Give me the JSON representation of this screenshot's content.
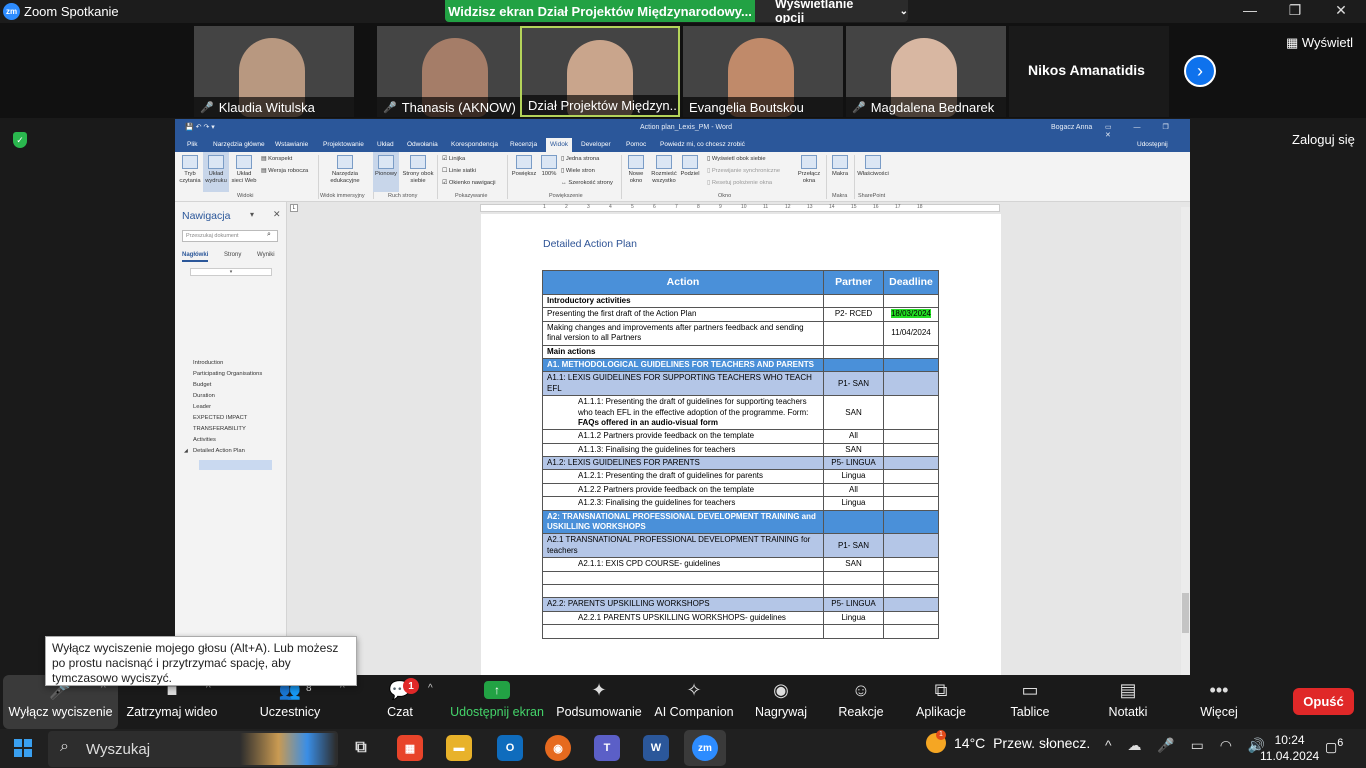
{
  "app": {
    "title": "Zoom Spotkanie",
    "logo_text": "zm"
  },
  "share_banner": {
    "text": "Widzisz ekran Dział Projektów Międzynarodowy...",
    "view_options": "Wyświetlanie opcji"
  },
  "window_controls": {
    "minimize": "—",
    "maximize": "❐",
    "close": "✕"
  },
  "participants": [
    {
      "name": "Klaudia Witulska",
      "muted": true,
      "face": "#b89880"
    },
    {
      "name": "Thanasis (AKNOW)",
      "muted": true,
      "face": "#a57d68"
    },
    {
      "name": "Dział Projektów Międzyn...",
      "muted": false,
      "face": "#c9a58c"
    },
    {
      "name": "Evangelia Boutskou",
      "muted": false,
      "face": "#c08a6a"
    },
    {
      "name": "Magdalena Bednarek",
      "muted": true,
      "face": "#d8b7a2"
    },
    {
      "name": "Nikos Amanatidis",
      "muted": true
    }
  ],
  "strip": {
    "featured_name": "Nikos Amanatidis",
    "view_label": "Wyświetl",
    "next_icon": "chevron-right-icon"
  },
  "side": {
    "login": "Zaloguj się"
  },
  "word": {
    "title": "Action plan_Lexis_PM  -  Word",
    "user": "Bogacz Anna",
    "tabs": [
      "Plik",
      "Narzędzia główne",
      "Wstawianie",
      "Projektowanie",
      "Układ",
      "Odwołania",
      "Korespondencja",
      "Recenzja",
      "Widok",
      "Developer",
      "Pomoc",
      "Powiedz mi, co chcesz zrobić"
    ],
    "active_tab": "Widok",
    "share": "Udostępnij",
    "ribbon": {
      "views": [
        "Tryb czytania",
        "Układ wydruku",
        "Układ sieci Web"
      ],
      "views_small": [
        "Konspekt",
        "Wersja robocza"
      ],
      "views_group": "Widoki",
      "immersive": "Narzędzia edukacyjne",
      "immersive_group": "Widok immersyjny",
      "movement": [
        "Pionowy",
        "Strony obok siebie"
      ],
      "movement_group": "Ruch strony",
      "show": [
        "Linijka",
        "Linie siatki",
        "Okienko nawigacji"
      ],
      "show_group": "Pokazywanie",
      "zoom": [
        "Powiększ",
        "100%"
      ],
      "zoom_small": [
        "Jedna strona",
        "Wiele stron",
        "Szerokość strony"
      ],
      "zoom_group": "Powiększenie",
      "window": [
        "Nowe okno",
        "Rozmieść wszystko",
        "Podziel"
      ],
      "window_small": [
        "Wyświetl obok siebie",
        "Przewijanie synchroniczne",
        "Resetuj położenie okna"
      ],
      "window_switch": "Przełącz okna",
      "window_group": "Okno",
      "macros": "Makra",
      "macros_group": "Makra",
      "props": "Właściwości",
      "sharepoint_group": "SharePoint"
    },
    "nav": {
      "title": "Nawigacja",
      "search_placeholder": "Przeszukaj dokument",
      "tabs": [
        "Nagłówki",
        "Strony",
        "Wyniki"
      ],
      "items": [
        "Introduction",
        "Participating Organisations",
        "Budget",
        "Duration",
        "Leader",
        "EXPECTED IMPACT",
        "TRANSFERABILITY",
        "Activities",
        "Detailed Action Plan"
      ]
    },
    "doc": {
      "heading": "Detailed Action Plan",
      "headers": [
        "Action",
        "Partner",
        "Deadline"
      ],
      "rows": [
        {
          "type": "plain",
          "action": "Introductory activities",
          "partner": "",
          "deadline": "",
          "bold": true
        },
        {
          "type": "plain",
          "action": "Presenting the first draft of the Action Plan",
          "partner": "P2- RCED",
          "deadline": "18/03/2024",
          "hl": true
        },
        {
          "type": "plain",
          "action": "Making changes and improvements after partners feedback and sending final version to all Partners",
          "partner": "",
          "deadline": "11/04/2024"
        },
        {
          "type": "plain",
          "action": "Main actions",
          "partner": "",
          "deadline": "",
          "bold": true
        },
        {
          "type": "sec",
          "action": "A1. METHODOLOGICAL GUIDELINES FOR TEACHERS AND PARENTS",
          "partner": "",
          "deadline": ""
        },
        {
          "type": "sub",
          "action": "A1.1: LEXIS GUIDELINES FOR SUPPORTING TEACHERS WHO TEACH EFL",
          "partner": "P1- SAN",
          "deadline": ""
        },
        {
          "type": "ind",
          "action": "A1.1.1: Presenting the draft of guidelines for supporting teachers who teach EFL in the effective adoption of the programme. Form: ",
          "action_bold": "FAQs offered in an audio-visual form",
          "partner": "SAN",
          "deadline": ""
        },
        {
          "type": "ind",
          "action": "A1.1.2 Partners provide feedback on the template",
          "partner": "All",
          "deadline": ""
        },
        {
          "type": "ind",
          "action": "A1.1.3: Finalising the guidelines for teachers",
          "partner": "SAN",
          "deadline": ""
        },
        {
          "type": "sub",
          "action": "A1.2: LEXIS GUIDELINES FOR PARENTS",
          "partner": "P5- LINGUA",
          "deadline": ""
        },
        {
          "type": "ind",
          "action": "A1.2.1: Presenting the draft of guidelines for parents",
          "partner": "Lingua",
          "deadline": ""
        },
        {
          "type": "ind",
          "action": "A1.2.2 Partners provide feedback on the template",
          "partner": "All",
          "deadline": ""
        },
        {
          "type": "ind",
          "action": "A1.2.3: Finalising the guidelines for teachers",
          "partner": "Lingua",
          "deadline": ""
        },
        {
          "type": "sec",
          "action": "A2: TRANSNATIONAL PROFESSIONAL DEVELOPMENT TRAINING and USKILLING WORKSHOPS",
          "partner": "",
          "deadline": ""
        },
        {
          "type": "sub",
          "action": "A2.1 TRANSNATIONAL PROFESSIONAL DEVELOPMENT TRAINING for teachers",
          "partner": "P1- SAN",
          "deadline": ""
        },
        {
          "type": "ind",
          "action": "A2.1.1: EXIS CPD COURSE- guidelines",
          "partner": "SAN",
          "deadline": ""
        },
        {
          "type": "ind",
          "action": "",
          "partner": "",
          "deadline": ""
        },
        {
          "type": "ind",
          "action": "",
          "partner": "",
          "deadline": ""
        },
        {
          "type": "sub",
          "action": "A2.2: PARENTS UPSKILLING WORKSHOPS",
          "partner": "P5- LINGUA",
          "deadline": ""
        },
        {
          "type": "ind",
          "action": "A2.2.1  PARENTS UPSKILLING WORKSHOPS- guidelines",
          "partner": "Lingua",
          "deadline": ""
        },
        {
          "type": "ind",
          "action": "",
          "partner": "",
          "deadline": ""
        }
      ]
    }
  },
  "tooltip": "Wyłącz wyciszenie mojego głosu (Alt+A). Lub możesz po prostu nacisnąć i przytrzymać spację, aby tymczasowo wyciszyć.",
  "toolbar": {
    "mute": "Wyłącz wyciszenie",
    "video": "Zatrzymaj wideo",
    "participants": "Uczestnicy",
    "participants_count": "8",
    "chat": "Czat",
    "chat_badge": "1",
    "share": "Udostępnij ekran",
    "summary": "Podsumowanie",
    "ai": "AI Companion",
    "record": "Nagrywaj",
    "reactions": "Reakcje",
    "apps": "Aplikacje",
    "whiteboards": "Tablice",
    "notes": "Notatki",
    "more": "Więcej",
    "leave": "Opuść"
  },
  "taskbar": {
    "search": "Wyszukaj",
    "weather_temp": "14°C",
    "weather_desc": "Przew. słonecz.",
    "weather_badge": "1",
    "time": "10:24",
    "date": "11.04.2024",
    "notifications": "6"
  }
}
